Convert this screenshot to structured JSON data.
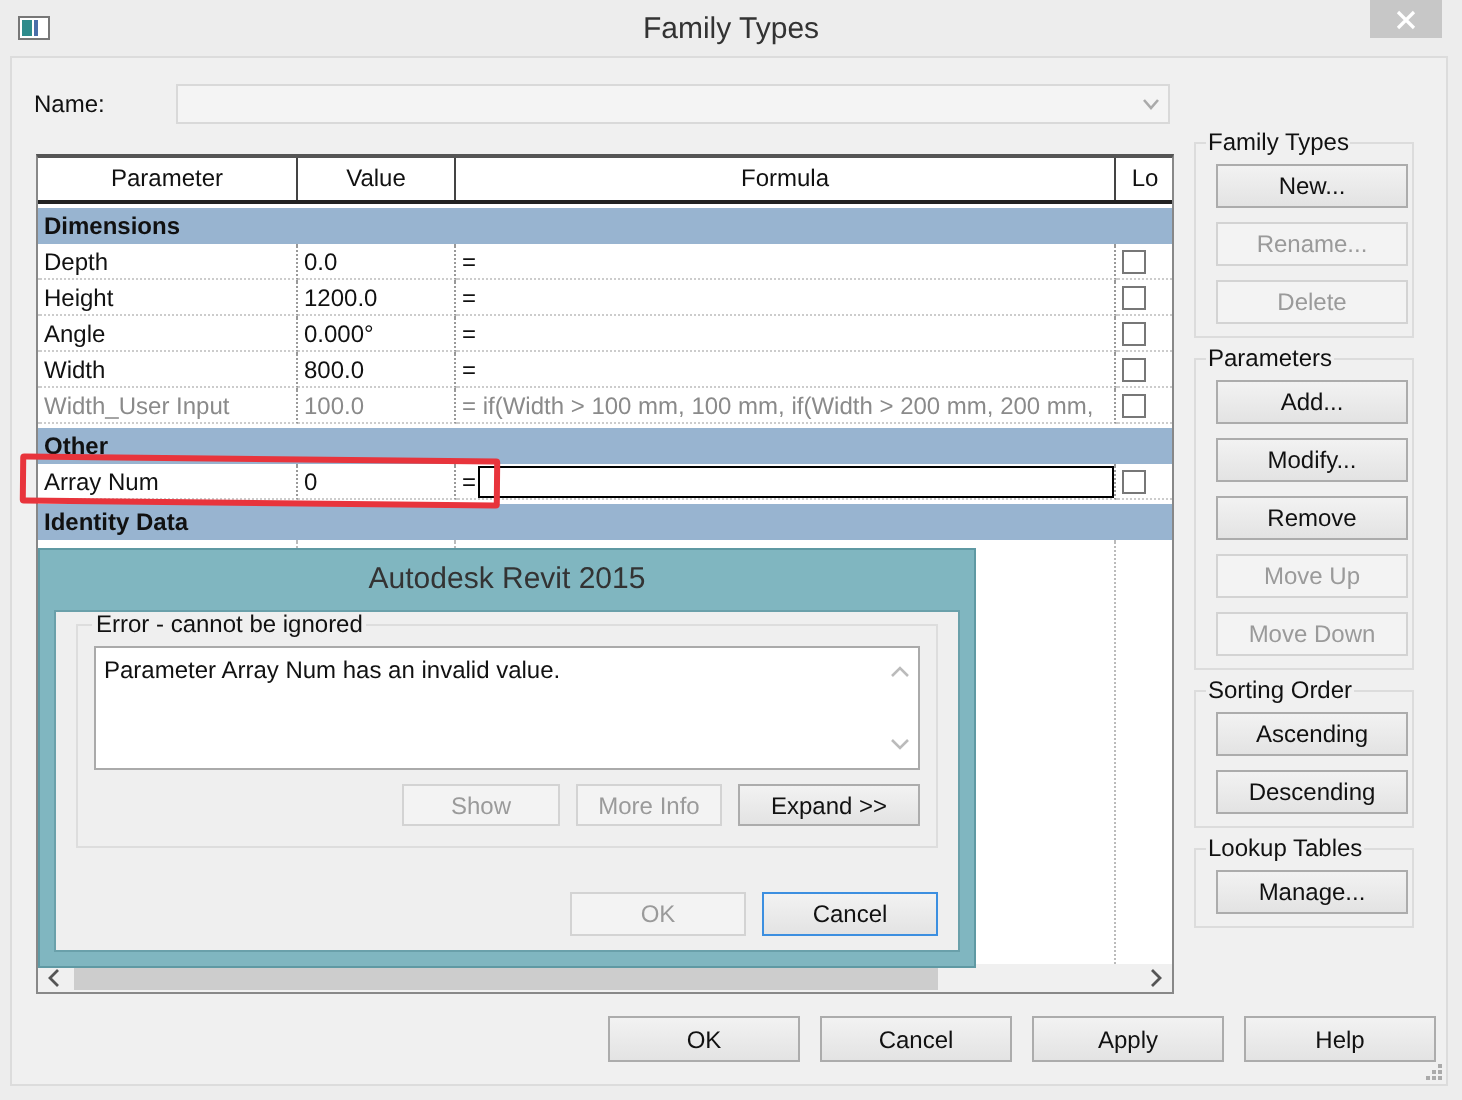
{
  "window": {
    "title": "Family Types"
  },
  "name_field": {
    "label": "Name:",
    "disabled": true
  },
  "table": {
    "columns": [
      "Parameter",
      "Value",
      "Formula",
      "Lo"
    ],
    "groups": [
      {
        "name": "Dimensions",
        "rows": [
          {
            "parameter": "Depth",
            "value": "0.0",
            "formula": "=",
            "locked": false,
            "disabled": false,
            "editing": false
          },
          {
            "parameter": "Height",
            "value": "1200.0",
            "formula": "=",
            "locked": false,
            "disabled": false,
            "editing": false
          },
          {
            "parameter": "Angle",
            "value": "0.000°",
            "formula": "=",
            "locked": false,
            "disabled": false,
            "editing": false
          },
          {
            "parameter": "Width",
            "value": "800.0",
            "formula": "=",
            "locked": false,
            "disabled": false,
            "editing": false
          },
          {
            "parameter": "Width_User Input",
            "value": "100.0",
            "formula": "= if(Width > 100 mm, 100 mm, if(Width > 200 mm, 200 mm,",
            "locked": false,
            "disabled": true,
            "editing": false
          }
        ]
      },
      {
        "name": "Other",
        "rows": [
          {
            "parameter": "Array Num",
            "value": "0",
            "formula": "=",
            "locked": false,
            "disabled": false,
            "editing": true
          }
        ]
      },
      {
        "name": "Identity Data"
      }
    ]
  },
  "side_groups": [
    {
      "title": "Family Types",
      "buttons": [
        {
          "label": "New...",
          "disabled": false
        },
        {
          "label": "Rename...",
          "disabled": true
        },
        {
          "label": "Delete",
          "disabled": true
        }
      ]
    },
    {
      "title": "Parameters",
      "buttons": [
        {
          "label": "Add...",
          "disabled": false
        },
        {
          "label": "Modify...",
          "disabled": false
        },
        {
          "label": "Remove",
          "disabled": false
        },
        {
          "label": "Move Up",
          "disabled": true
        },
        {
          "label": "Move Down",
          "disabled": true
        }
      ]
    },
    {
      "title": "Sorting Order",
      "buttons": [
        {
          "label": "Ascending",
          "disabled": false
        },
        {
          "label": "Descending",
          "disabled": false
        }
      ]
    },
    {
      "title": "Lookup Tables",
      "buttons": [
        {
          "label": "Manage...",
          "disabled": false
        }
      ]
    }
  ],
  "buttons": [
    {
      "label": "OK",
      "disabled": false
    },
    {
      "label": "Cancel",
      "disabled": false
    },
    {
      "label": "Apply",
      "disabled": false
    },
    {
      "label": "Help",
      "disabled": false
    }
  ],
  "error_dialog": {
    "title": "Autodesk Revit 2015",
    "group_title": "Error - cannot be ignored",
    "message": "Parameter Array Num has an invalid value.",
    "buttons": [
      {
        "label": "Show",
        "disabled": true,
        "focused": false
      },
      {
        "label": "More Info",
        "disabled": true,
        "focused": false
      },
      {
        "label": "Expand >>",
        "disabled": false,
        "focused": false
      }
    ],
    "footer_buttons": [
      {
        "label": "OK",
        "disabled": true,
        "focused": false
      },
      {
        "label": "Cancel",
        "disabled": false,
        "focused": true
      }
    ]
  }
}
